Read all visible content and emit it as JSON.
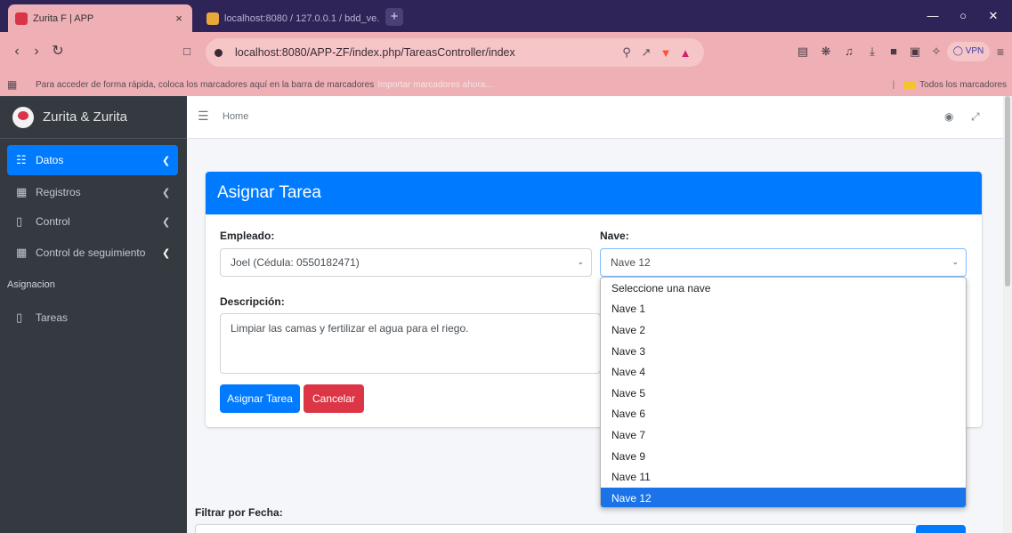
{
  "browser": {
    "tabs": [
      {
        "title": "Zurita F | APP",
        "close": "×"
      },
      {
        "title": "localhost:8080 / 127.0.0.1 / bdd_ve..."
      }
    ],
    "new_tab": "+",
    "url": "localhost:8080/APP-ZF/index.php/TareasController/index",
    "vpn_label": "VPN",
    "bookmarks_message": "Para acceder de forma rápida, coloca los marcadores aquí en la barra de marcadores",
    "bookmarks_import": "Importar marcadores ahora...",
    "all_bookmarks": "Todos los marcadores"
  },
  "sidebar": {
    "brand": "Zurita & Zurita",
    "items": [
      {
        "label": "Datos",
        "icon": "id-card-icon"
      },
      {
        "label": "Registros",
        "icon": "table-icon"
      },
      {
        "label": "Control",
        "icon": "clipboard-icon"
      },
      {
        "label": "Control de seguimiento",
        "icon": "table-icon"
      }
    ],
    "section_header": "Asignacion",
    "section_items": [
      {
        "label": "Tareas",
        "icon": "clipboard-icon"
      }
    ]
  },
  "topnav": {
    "home": "Home"
  },
  "form": {
    "title": "Asignar Tarea",
    "employee_label": "Empleado:",
    "employee_value": "Joel (Cédula: 0550182471)",
    "nave_label": "Nave:",
    "nave_value": "Nave 12",
    "description_label": "Descripción:",
    "description_value": "Limpiar las camas y fertilizar el agua para el riego.",
    "submit_label": "Asignar Tarea",
    "cancel_label": "Cancelar"
  },
  "nave_options": [
    "Seleccione una nave",
    "Nave 1",
    "Nave 2",
    "Nave 3",
    "Nave 4",
    "Nave 5",
    "Nave 6",
    "Nave 7",
    "Nave 9",
    "Nave 11",
    "Nave 12"
  ],
  "nave_selected_index": 10,
  "filter": {
    "label": "Filtrar por Fecha:"
  },
  "colors": {
    "primary": "#007bff",
    "danger": "#dc3545",
    "sidebar_bg": "#343a40",
    "browser_chrome": "#eeb0b4",
    "tab_strip": "#2e2458"
  }
}
